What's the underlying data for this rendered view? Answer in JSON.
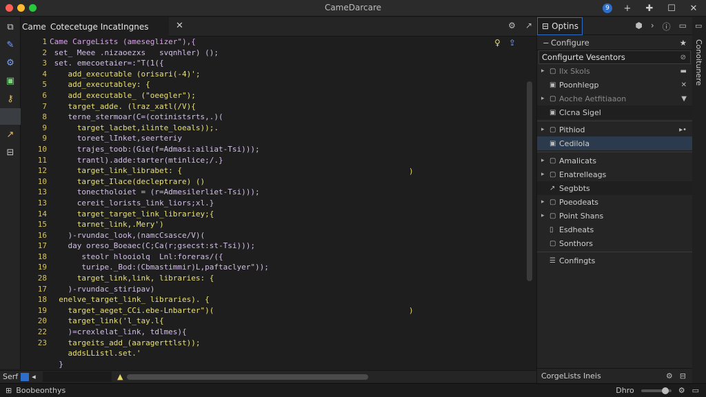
{
  "window": {
    "title": "CameDarcare",
    "colors": {
      "close": "#ff5f56",
      "minimize": "#ffbd2e",
      "maximize": "#27c93f",
      "accent": "#2f6ec8"
    },
    "notification_count": "9"
  },
  "tab": {
    "prefix": "Came",
    "title": "Cotecetuge IncatIngnes"
  },
  "editor": {
    "line_numbers": [
      "1",
      "2",
      "3",
      "4",
      "5",
      "6",
      "7",
      "8",
      "9",
      "9",
      "10",
      "11",
      "12",
      "10",
      "13",
      "13",
      "14",
      "15",
      "16",
      "17",
      "18",
      "19",
      "28",
      "17",
      "18",
      "19",
      "20",
      "22",
      "23"
    ],
    "lines": [
      {
        "text": "Came CargeLists (ameseglizer\"),{",
        "color": "#d7a6e6"
      },
      {
        "text": " set_ Meee .nizaoezxs   svqnhler) ();",
        "color": "#d3c0e8"
      },
      {
        "text": " set. emecoetaier=:\"T(1({",
        "color": "#d3c0e8"
      },
      {
        "text": "    add_executable (orisari(-4)';",
        "color": "#e8e07a"
      },
      {
        "text": "    add_executabley: {",
        "color": "#e8e07a"
      },
      {
        "text": "    add_executable_ (\"oeegler\");",
        "color": "#e8e07a"
      },
      {
        "text": "    target_adde. (lraz_xatl(/V){",
        "color": "#e8e07a"
      },
      {
        "text": "    terne_stermoar(C=(cotinistsrts,.)(",
        "color": "#d3c0e8"
      },
      {
        "text": "      target_lacbet,ilinte_loeals));.",
        "color": "#e8e07a"
      },
      {
        "text": "      toreet_lInket,seerteriy",
        "color": "#d3c0e8"
      },
      {
        "text": "      trajes_toob:(Gie(f=Admasi:ailiat-Tsi)));",
        "color": "#d3c0e8"
      },
      {
        "text": "      trantl).adde:tarter(mtinlice;/.}",
        "color": "#d3c0e8"
      },
      {
        "text": "      target_link_librabet: {",
        "color": "#e8e07a"
      },
      {
        "text": "      target_Ilace(decleptrare) ()",
        "color": "#e8e07a"
      },
      {
        "text": "      tonectholoiet = (r=Admesilerliet-Tsi)));",
        "color": "#d3c0e8"
      },
      {
        "text": "      cereit_lorists_link_liors;xl.}",
        "color": "#d3c0e8"
      },
      {
        "text": "      target_target_link_librariey;{",
        "color": "#e8e07a"
      },
      {
        "text": "      tarnet_link,.Mery')",
        "color": "#e8e07a"
      },
      {
        "text": "    )-rvundac_look,(namcCsasce/V)(",
        "color": "#d3c0e8"
      },
      {
        "text": "    day oreso_Boeaec(C;Ca(r;gsecst:st-Tsi)));",
        "color": "#d3c0e8"
      },
      {
        "text": "       steolr hlooiolq  Lnl:foreras/({",
        "color": "#d3c0e8"
      },
      {
        "text": "       turipe._Bod:(Cbmastimmir)L,paftaclyer\"));",
        "color": "#d3c0e8"
      },
      {
        "text": "      target_link,link, libraries: {",
        "color": "#e8e07a"
      },
      {
        "text": "    )-rvundac_stiripav)",
        "color": "#d3c0e8"
      },
      {
        "text": "  enelve_target_link_ libraries). {",
        "color": "#e8e07a"
      },
      {
        "text": "    target_aeget_CCi.ebe-Lnbarter\")(",
        "color": "#e8e07a"
      },
      {
        "text": "    target_link('l_tay.l{",
        "color": "#e8e07a"
      },
      {
        "text": "    )=crexlelat_link, tdlmes){",
        "color": "#d3c0e8"
      },
      {
        "text": "    targeits_add_(aaragerttlst));",
        "color": "#e8e07a"
      },
      {
        "text": "    addsLListl.set.'",
        "color": "#e8e07a"
      },
      {
        "text": "  }",
        "color": "#d3c0e8"
      }
    ],
    "bracket_marks": [
      ")",
      ")"
    ]
  },
  "editor_bottom": {
    "label": "Serf"
  },
  "statusbar": {
    "left": "Boobeonthys",
    "right": "Dhro"
  },
  "right_panel": {
    "tab_label": "Optins",
    "section": "Configure",
    "input_value": "Configurte Vesentors",
    "items": [
      {
        "label": "Ilx Skols",
        "style": "dim"
      },
      {
        "label": "Poonhlegp",
        "style": "normal"
      },
      {
        "label": "Aoche Aetfitiaaon",
        "style": "dim"
      },
      {
        "label": "Clcna Sigel",
        "style": "dark"
      },
      {
        "label": "Pithiod",
        "style": "normal"
      },
      {
        "label": "Cedilola",
        "style": "sel"
      },
      {
        "label": "Amalicats",
        "style": "normal"
      },
      {
        "label": "Enatrelleags",
        "style": "normal"
      },
      {
        "label": "Segbbts",
        "style": "dark"
      },
      {
        "label": "Poeodeats",
        "style": "normal"
      },
      {
        "label": "Point Shans",
        "style": "normal"
      },
      {
        "label": "Esdheats",
        "style": "normal"
      },
      {
        "label": "Sonthors",
        "style": "normal"
      },
      {
        "label": "Confingts",
        "style": "normal"
      }
    ],
    "bottom_label": "CorgeLists Ineis",
    "vertical_label": "Conoitunere"
  }
}
